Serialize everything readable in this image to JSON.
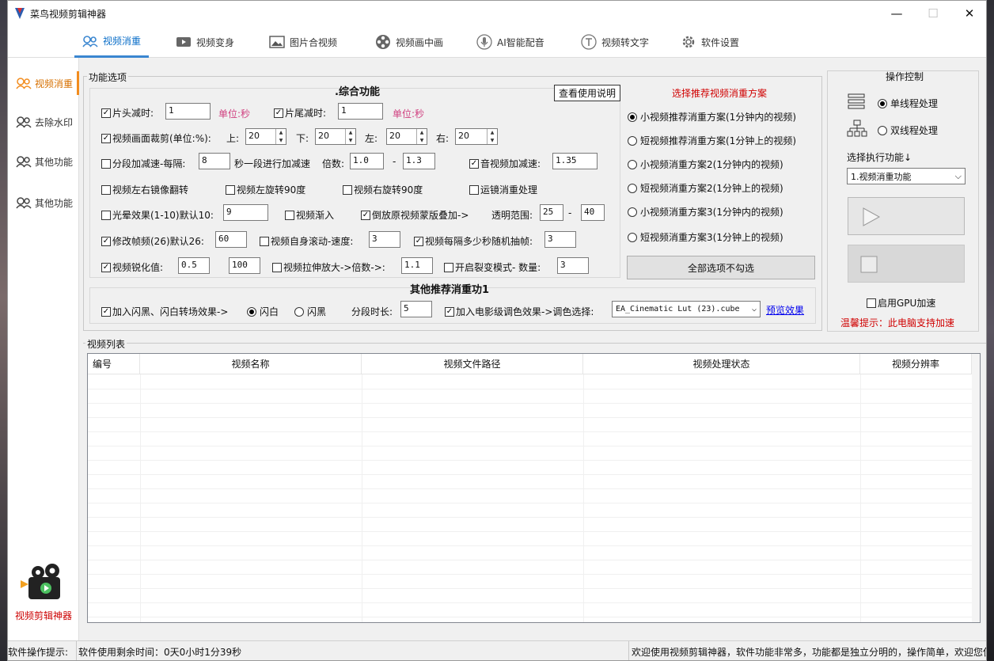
{
  "window": {
    "title": "菜鸟视频剪辑神器",
    "minimize": "—",
    "maximize": "☐",
    "close": "✕"
  },
  "nav": {
    "tabs": [
      "视频消重",
      "视频变身",
      "图片合视频",
      "视频画中画",
      "AI智能配音",
      "视频转文字",
      "软件设置"
    ]
  },
  "sidebar": {
    "items": [
      "视频消重",
      "去除水印",
      "其他功能",
      "其他功能"
    ],
    "logo_text": "视频剪辑神器"
  },
  "options": {
    "group_title": "功能选项",
    "section_title": ".综合功能",
    "help_button": "查看使用说明",
    "head_cut": {
      "label": "片头减时:",
      "value": "1",
      "unit": "单位:秒"
    },
    "tail_cut": {
      "label": "片尾减时:",
      "value": "1",
      "unit": "单位:秒"
    },
    "crop": {
      "label": "视频画面裁剪(单位:%):",
      "top_label": "上:",
      "top": "20",
      "bottom_label": "下:",
      "bottom": "20",
      "left_label": "左:",
      "left": "20",
      "right_label": "右:",
      "right": "20"
    },
    "segment": {
      "label": "分段加减速-每隔:",
      "value": "8",
      "mid": "秒一段进行加减速",
      "mult_label": "倍数:",
      "from": "1.0",
      "dash": "-",
      "to": "1.3"
    },
    "av_speed": {
      "label": "音视频加减速:",
      "value": "1.35"
    },
    "mirror": "视频左右镜像翻转",
    "rotate_left": "视频左旋转90度",
    "rotate_right": "视频右旋转90度",
    "motion": "运镜消重处理",
    "halo": {
      "label": "光晕效果(1-10)默认10:",
      "value": "9"
    },
    "fade_in": "视频渐入",
    "mask": {
      "label": "倒放原视频蒙版叠加->",
      "range_label": "透明范围:",
      "from": "25",
      "dash": "-",
      "to": "40"
    },
    "fps": {
      "label": "修改帧频(26)默认26:",
      "value": "60"
    },
    "scroll": {
      "label": "视频自身滚动-速度:",
      "value": "3"
    },
    "drop_frame": {
      "label": "视频每隔多少秒随机抽帧:",
      "value": "3"
    },
    "sharpen": {
      "label": "视频锐化值:",
      "value": "0.5",
      "value2": "100"
    },
    "stretch": {
      "label": "视频拉伸放大->倍数->:",
      "value": "1.1"
    },
    "crack": {
      "label": "开启裂变模式- 数量:",
      "value": "3"
    },
    "other_title": "其他推荐消重功1",
    "flash": {
      "label": "加入闪黑、闪白转场效果->",
      "white": "闪白",
      "black": "闪黑",
      "seg_label": "分段时长:",
      "seg_value": "5"
    },
    "lut": {
      "label": "加入电影级调色效果->调色选择:",
      "value": "EA_Cinematic Lut (23).cube",
      "preview": "预览效果"
    }
  },
  "schemes": {
    "title": "选择推荐视频消重方案",
    "items": [
      "小视频推荐消重方案(1分钟内的视频)",
      "短视频推荐消重方案(1分钟上的视频)",
      "小视频消重方案2(1分钟内的视频)",
      "短视频消重方案2(1分钟上的视频)",
      "小视频消重方案3(1分钟内的视频)",
      "短视频消重方案3(1分钟上的视频)"
    ],
    "selected": 0,
    "uncheck_all": "全部选项不勾选"
  },
  "control": {
    "title": "操作控制",
    "single": "单线程处理",
    "dual": "双线程处理",
    "select_label": "选择执行功能↓",
    "select_value": "1.视频消重功能",
    "gpu": "启用GPU加速",
    "hint": "温馨提示：此电脑支持加速"
  },
  "list": {
    "title": "视频列表",
    "columns": [
      "编号",
      "视频名称",
      "视频文件路径",
      "视频处理状态",
      "视频分辨率"
    ]
  },
  "status": {
    "label": "软件操作提示:",
    "remaining": "软件使用剩余时间：0天0小时1分39秒",
    "welcome": "欢迎使用视频剪辑神器，软件功能非常多，功能都是独立分明的，操作简单，欢迎您使"
  },
  "colors": {
    "accent": "#0a6ec8",
    "orange": "#f28c1e",
    "red": "#d00000",
    "link": "#0000ee"
  }
}
